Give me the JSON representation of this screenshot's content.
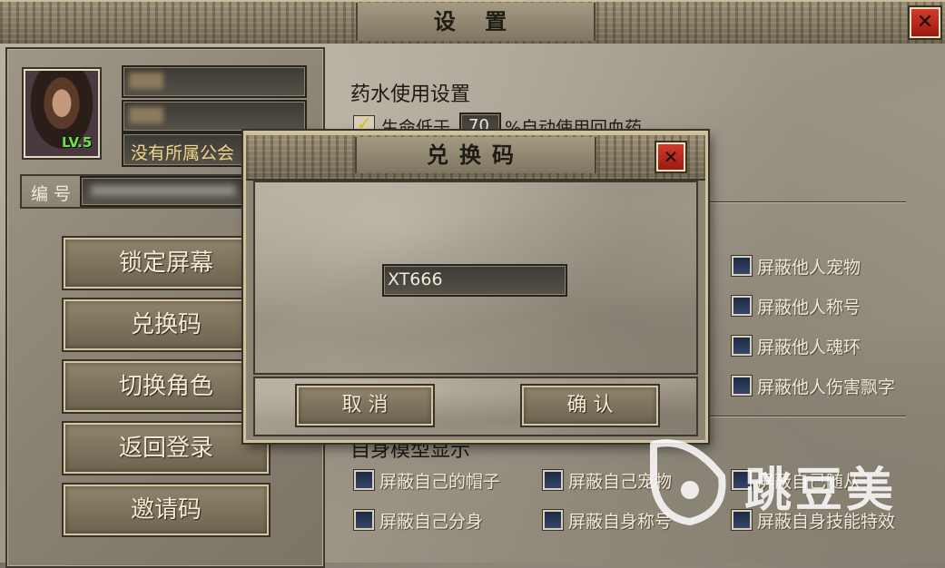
{
  "window": {
    "title": "设 置",
    "close_label": "✕"
  },
  "profile": {
    "level": "LV.5",
    "guild": "没有所属公会",
    "id_label": "编 号"
  },
  "menu": {
    "items": [
      {
        "label": "锁定屏幕"
      },
      {
        "label": "兑换码"
      },
      {
        "label": "切换角色"
      },
      {
        "label": "返回登录"
      },
      {
        "label": "邀请码"
      }
    ]
  },
  "settings": {
    "potion_title": "药水使用设置",
    "potion_line_a": "生命低于",
    "potion_value": "70",
    "potion_line_b": "%自动使用回血药",
    "other_options": [
      {
        "label": "屏蔽他人宠物"
      },
      {
        "label": "屏蔽他人称号"
      },
      {
        "label": "屏蔽他人魂环"
      },
      {
        "label": "屏蔽他人伤害飘字"
      }
    ],
    "self_title": "自身模型显示",
    "self_options": [
      {
        "label": "屏蔽自己的帽子"
      },
      {
        "label": "屏蔽自己宠物"
      },
      {
        "label": "屏蔽自己随从"
      },
      {
        "label": "屏蔽自己分身"
      },
      {
        "label": "屏蔽自身称号"
      },
      {
        "label": "屏蔽自身技能特效"
      }
    ]
  },
  "dialog": {
    "title": "兑换码",
    "close_label": "✕",
    "code_value": "XT666",
    "cancel_label": "取 消",
    "confirm_label": "确 认"
  },
  "watermark": {
    "text": "跳豆美"
  },
  "colors": {
    "accent_gold": "#f0d48a",
    "level_green": "#6fe04a",
    "close_red": "#c0281c"
  }
}
